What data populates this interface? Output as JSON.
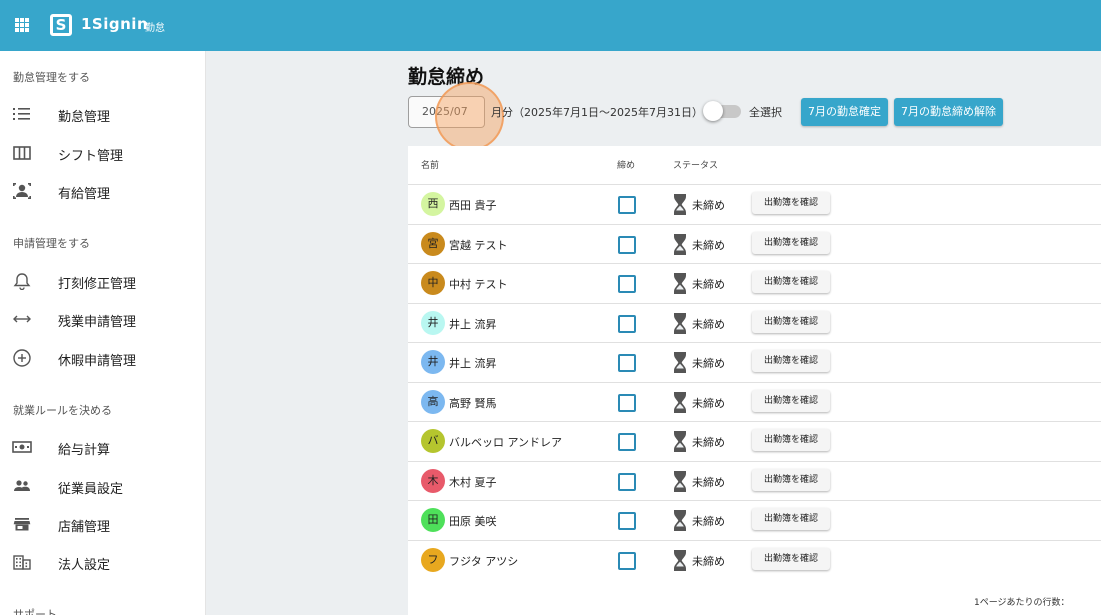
{
  "app": {
    "name": "1Signin",
    "subtitle": "勤怠",
    "logo_letter": "S"
  },
  "sidebar": {
    "sections": [
      {
        "header": "勤怠管理をする",
        "items": [
          {
            "label": "勤怠管理",
            "icon": "list-icon"
          },
          {
            "label": "シフト管理",
            "icon": "columns-icon"
          },
          {
            "label": "有給管理",
            "icon": "person-icon"
          }
        ]
      },
      {
        "header": "申請管理をする",
        "items": [
          {
            "label": "打刻修正管理",
            "icon": "bell-icon"
          },
          {
            "label": "残業申請管理",
            "icon": "arrows-horizontal-icon"
          },
          {
            "label": "休暇申請管理",
            "icon": "plus-circle-icon"
          }
        ]
      },
      {
        "header": "就業ルールを決める",
        "items": [
          {
            "label": "給与計算",
            "icon": "money-icon"
          },
          {
            "label": "従業員設定",
            "icon": "people-icon"
          },
          {
            "label": "店舗管理",
            "icon": "store-icon"
          },
          {
            "label": "法人設定",
            "icon": "building-icon"
          }
        ]
      },
      {
        "header": "サポート",
        "items": []
      }
    ]
  },
  "main": {
    "title": "勤怠締め",
    "month_value": "2025/07",
    "range_text": "月分（2025年7月1日〜2025年7月31日）",
    "select_all_label": "全選択",
    "select_all_on": false,
    "confirm_button": "7月の勤怠確定",
    "unlock_button": "7月の勤怠締め解除",
    "accent_color": "#37a6cb",
    "table": {
      "headers": {
        "name": "名前",
        "closing": "締め",
        "status": "ステータス"
      },
      "rows": [
        {
          "initial": "西",
          "name": "西田 貴子",
          "avatar_color": "#d4f5a0",
          "status": "未締め",
          "button": "出勤簿を確認"
        },
        {
          "initial": "宮",
          "name": "宮越 テスト",
          "avatar_color": "#c98a1d",
          "status": "未締め",
          "button": "出勤簿を確認"
        },
        {
          "initial": "中",
          "name": "中村 テスト",
          "avatar_color": "#c98a1d",
          "status": "未締め",
          "button": "出勤簿を確認"
        },
        {
          "initial": "井",
          "name": "井上 流昇",
          "avatar_color": "#b9f7f1",
          "status": "未締め",
          "button": "出勤簿を確認"
        },
        {
          "initial": "井",
          "name": "井上 流昇",
          "avatar_color": "#7cb8f0",
          "status": "未締め",
          "button": "出勤簿を確認"
        },
        {
          "initial": "高",
          "name": "高野 賢馬",
          "avatar_color": "#7cb8f0",
          "status": "未締め",
          "button": "出勤簿を確認"
        },
        {
          "initial": "バ",
          "name": "バルベッロ アンドレア",
          "avatar_color": "#b5c52e",
          "status": "未締め",
          "button": "出勤簿を確認"
        },
        {
          "initial": "木",
          "name": "木村 夏子",
          "avatar_color": "#e85a6a",
          "status": "未締め",
          "button": "出勤簿を確認"
        },
        {
          "initial": "田",
          "name": "田原 美咲",
          "avatar_color": "#4ee05a",
          "status": "未締め",
          "button": "出勤簿を確認"
        },
        {
          "initial": "フ",
          "name": "フジタ アツシ",
          "avatar_color": "#e8a81f",
          "status": "未締め",
          "button": "出勤簿を確認"
        }
      ]
    },
    "rows_per_page_label": "1ページあたりの行数："
  }
}
